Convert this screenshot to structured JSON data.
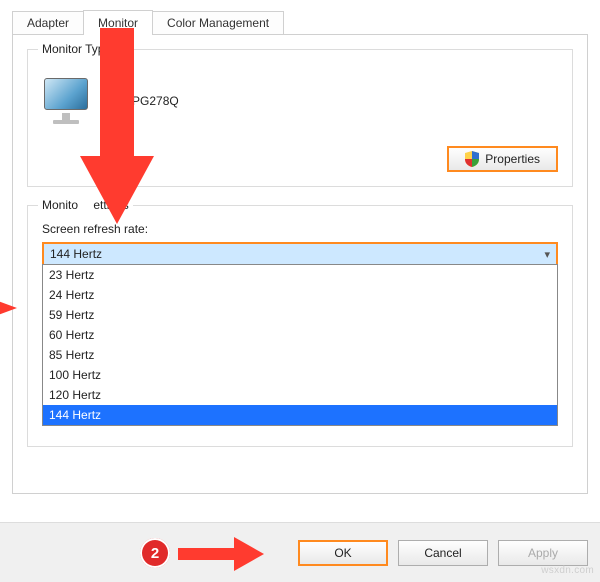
{
  "tabs": {
    "adapter": "Adapter",
    "monitor": "Monitor",
    "color_mgmt": "Color Management"
  },
  "monitor_type": {
    "legend": "Monitor Type",
    "name": "SUS PG278Q",
    "properties_btn": "Properties"
  },
  "monitor_settings": {
    "legend": "Monitor Settings",
    "refresh_label": "Screen refresh rate:",
    "selected": "144 Hertz",
    "options": [
      "23 Hertz",
      "24 Hertz",
      "59 Hertz",
      "60 Hertz",
      "85 Hertz",
      "100 Hertz",
      "120 Hertz",
      "144 Hertz"
    ]
  },
  "buttons": {
    "ok": "OK",
    "cancel": "Cancel",
    "apply": "Apply"
  },
  "annotations": {
    "step2": "2"
  },
  "watermark": "wsxdn.com"
}
